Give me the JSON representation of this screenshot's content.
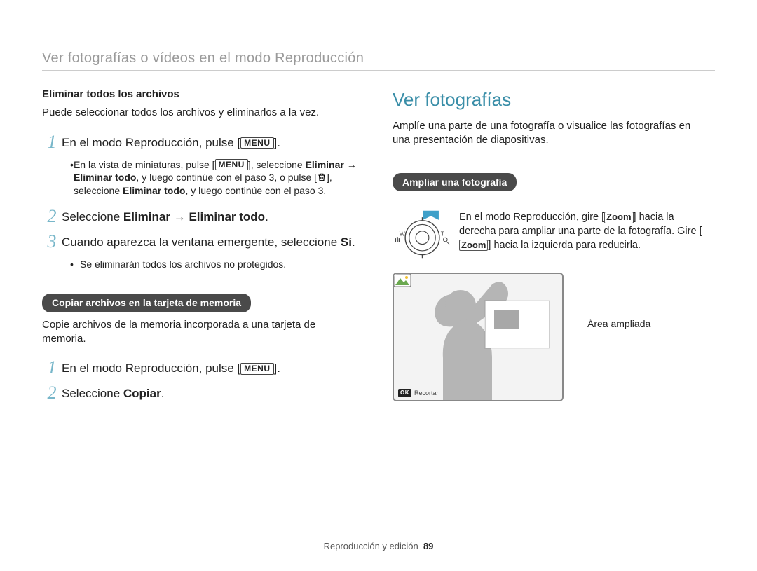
{
  "page_title": "Ver fotografías o vídeos en el modo Reproducción",
  "left": {
    "del_all_heading": "Eliminar todos los archivos",
    "del_all_intro": "Puede seleccionar todos los archivos y eliminarlos a la vez.",
    "step1_pre": "En el modo Reproducción, pulse [",
    "step1_post": "].",
    "menu_label": "MENU",
    "bul1_a": "En la vista de miniaturas, pulse [",
    "bul1_b": "], seleccione ",
    "bul1_c": "Eliminar",
    "bul1_d": " → ",
    "bul1_e": "Eliminar todo",
    "bul1_f": ", y luego continúe con el paso 3, o pulse [",
    "bul1_g": "], seleccione ",
    "bul1_h": "Eliminar todo",
    "bul1_i": ", y luego continúe con el paso 3.",
    "step2_a": "Seleccione ",
    "step2_b": "Eliminar",
    "step2_c": " → ",
    "step2_d": "Eliminar todo",
    "step2_e": ".",
    "step3_a": "Cuando aparezca la ventana emergente, seleccione ",
    "step3_b": "Sí",
    "step3_c": ".",
    "bul2": "Se eliminarán todos los archivos no protegidos.",
    "copy_pill": "Copiar archivos en la tarjeta de memoria",
    "copy_intro": "Copie archivos de la memoria incorporada a una tarjeta de memoria.",
    "copy_step1_pre": "En el modo Reproducción, pulse [",
    "copy_step1_post": "].",
    "copy_step2_a": "Seleccione ",
    "copy_step2_b": "Copiar",
    "copy_step2_c": "."
  },
  "right": {
    "section_title": "Ver fotografías",
    "intro": "Amplíe una parte de una fotografía o visualice las fotografías en una presentación de diapositivas.",
    "pill": "Ampliar una fotografía",
    "zoom_a": "En el modo Reproducción, gire [",
    "zoom_b": "Zoom",
    "zoom_c": "] hacia la derecha para ampliar una parte de la fotografía. Gire [",
    "zoom_d": "Zoom",
    "zoom_e": "] hacia la izquierda para reducirla.",
    "dial_w": "W",
    "dial_t": "T",
    "callout": "Área ampliada",
    "ok": "OK",
    "recortar": "Recortar"
  },
  "footer_section": "Reproducción y edición",
  "footer_page": "89"
}
